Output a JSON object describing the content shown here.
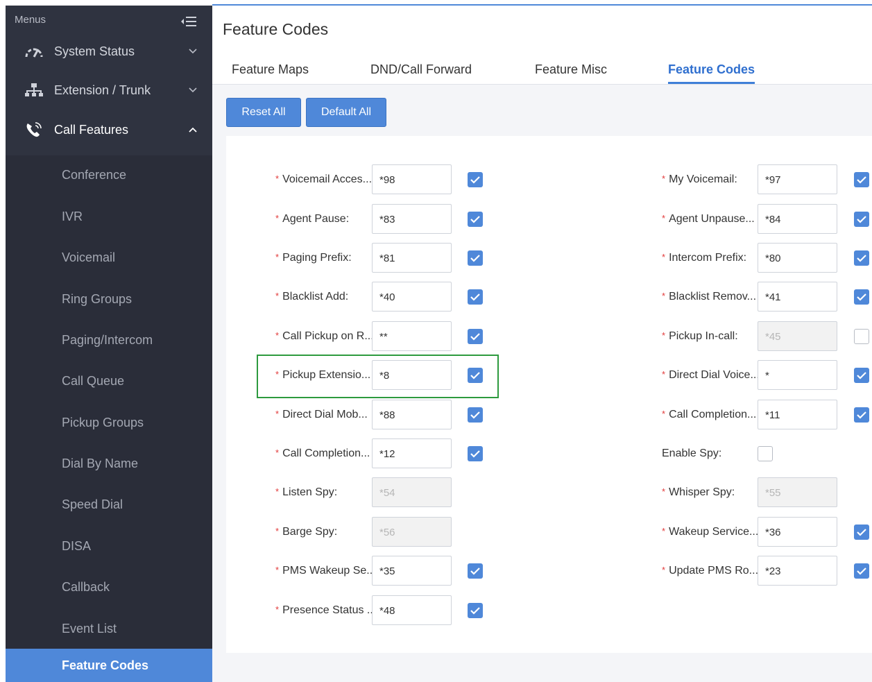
{
  "sidebar": {
    "header": "Menus",
    "top_items": [
      {
        "label": "System Status",
        "icon": "gauge-icon"
      },
      {
        "label": "Extension / Trunk",
        "icon": "network-icon"
      },
      {
        "label": "Call Features",
        "icon": "phone-icon"
      }
    ],
    "sub_items": [
      {
        "label": "Conference"
      },
      {
        "label": "IVR"
      },
      {
        "label": "Voicemail"
      },
      {
        "label": "Ring Groups"
      },
      {
        "label": "Paging/Intercom"
      },
      {
        "label": "Call Queue"
      },
      {
        "label": "Pickup Groups"
      },
      {
        "label": "Dial By Name"
      },
      {
        "label": "Speed Dial"
      },
      {
        "label": "DISA"
      },
      {
        "label": "Callback"
      },
      {
        "label": "Event List"
      },
      {
        "label": "Feature Codes"
      }
    ],
    "active_sub_item": "Feature Codes"
  },
  "main": {
    "title": "Feature Codes",
    "tabs": [
      "Feature Maps",
      "DND/Call Forward",
      "Feature Misc",
      "Feature Codes"
    ],
    "active_tab": "Feature Codes",
    "buttons": {
      "reset_all": "Reset All",
      "default_all": "Default All"
    }
  },
  "form": {
    "left": [
      {
        "label": "Voicemail Acces...",
        "required": true,
        "value": "*98",
        "disabled": false,
        "checked": true
      },
      {
        "label": "Agent Pause:",
        "required": true,
        "value": "*83",
        "disabled": false,
        "checked": true
      },
      {
        "label": "Paging Prefix:",
        "required": true,
        "value": "*81",
        "disabled": false,
        "checked": true
      },
      {
        "label": "Blacklist Add:",
        "required": true,
        "value": "*40",
        "disabled": false,
        "checked": true
      },
      {
        "label": "Call Pickup on R...",
        "required": true,
        "value": "**",
        "disabled": false,
        "checked": true
      },
      {
        "label": "Pickup Extensio...",
        "required": true,
        "value": "*8",
        "disabled": false,
        "checked": true
      },
      {
        "label": "Direct Dial Mob...",
        "required": true,
        "value": "*88",
        "disabled": false,
        "checked": true
      },
      {
        "label": "Call Completion...",
        "required": true,
        "value": "*12",
        "disabled": false,
        "checked": true
      },
      {
        "label": "Listen Spy:",
        "required": true,
        "value": "*54",
        "disabled": true,
        "checked": null
      },
      {
        "label": "Barge Spy:",
        "required": true,
        "value": "*56",
        "disabled": true,
        "checked": null
      },
      {
        "label": "PMS Wakeup Se...",
        "required": true,
        "value": "*35",
        "disabled": false,
        "checked": true
      },
      {
        "label": "Presence Status ...",
        "required": true,
        "value": "*48",
        "disabled": false,
        "checked": true
      }
    ],
    "right": [
      {
        "label": "My Voicemail:",
        "required": true,
        "value": "*97",
        "disabled": false,
        "checked": true
      },
      {
        "label": "Agent Unpause...",
        "required": true,
        "value": "*84",
        "disabled": false,
        "checked": true
      },
      {
        "label": "Intercom Prefix:",
        "required": true,
        "value": "*80",
        "disabled": false,
        "checked": true
      },
      {
        "label": "Blacklist Remov...",
        "required": true,
        "value": "*41",
        "disabled": false,
        "checked": true
      },
      {
        "label": "Pickup In-call:",
        "required": true,
        "value": "*45",
        "disabled": true,
        "checked": false
      },
      {
        "label": "Direct Dial Voice...",
        "required": true,
        "value": "*",
        "disabled": false,
        "checked": true
      },
      {
        "label": "Call Completion...",
        "required": true,
        "value": "*11",
        "disabled": false,
        "checked": true
      },
      {
        "label": "Enable Spy:",
        "required": false,
        "value": null,
        "disabled": false,
        "checked": false
      },
      {
        "label": "Whisper Spy:",
        "required": true,
        "value": "*55",
        "disabled": true,
        "checked": null
      },
      {
        "label": "Wakeup Service...",
        "required": true,
        "value": "*36",
        "disabled": false,
        "checked": true
      },
      {
        "label": "Update PMS Ro...",
        "required": true,
        "value": "*23",
        "disabled": false,
        "checked": true
      }
    ]
  },
  "colors": {
    "sidebar_bg": "#2f3340",
    "accent": "#4f88d9",
    "required_star": "#e23a3a",
    "highlight_box": "#2d9a3e"
  }
}
